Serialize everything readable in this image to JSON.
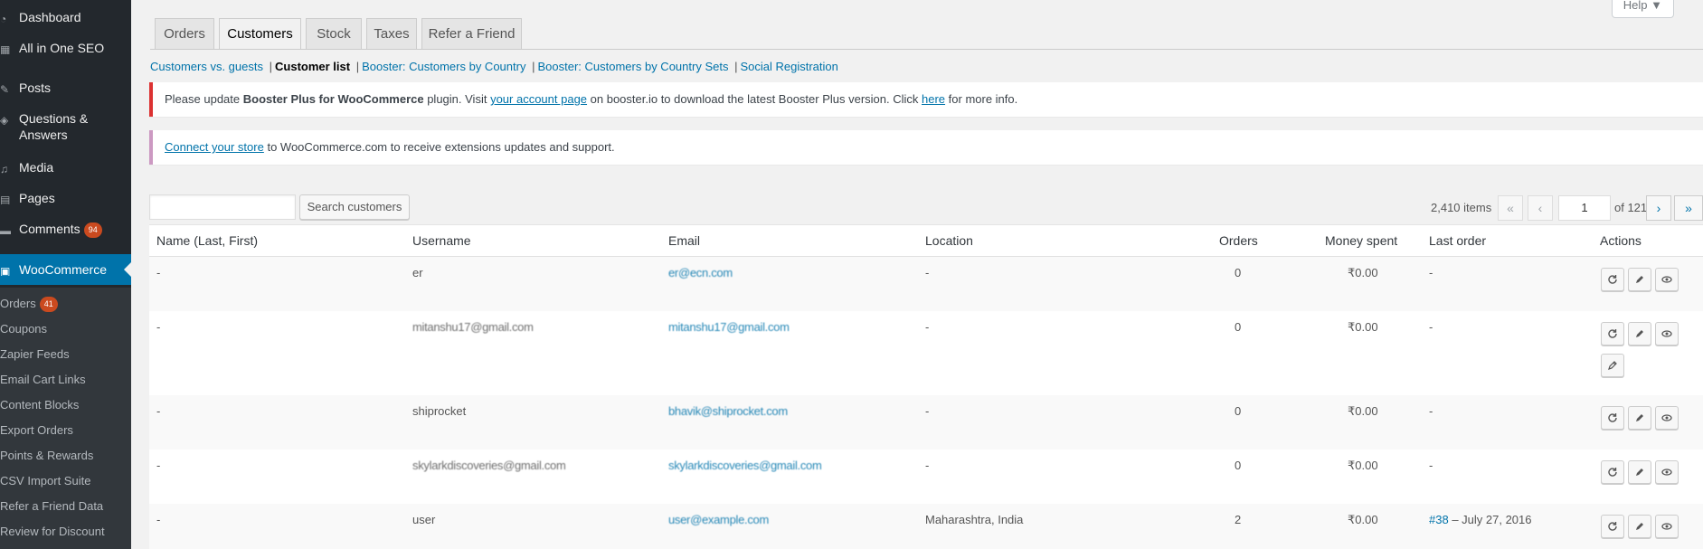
{
  "sidebar": {
    "items": [
      {
        "label": "Dashboard",
        "icon": "dashboard-icon"
      },
      {
        "label": "All in One SEO",
        "icon": "seo-icon"
      },
      {
        "label": "Posts",
        "icon": "pin-icon"
      },
      {
        "label": "Questions & Answers",
        "icon": "questions-icon"
      },
      {
        "label": "Media",
        "icon": "media-icon"
      },
      {
        "label": "Pages",
        "icon": "pages-icon"
      },
      {
        "label": "Comments",
        "icon": "comments-icon",
        "badge": "94"
      },
      {
        "label": "WooCommerce",
        "icon": "woocommerce-icon"
      }
    ],
    "submenu": [
      {
        "label": "Orders",
        "badge": "41"
      },
      {
        "label": "Coupons"
      },
      {
        "label": "Zapier Feeds"
      },
      {
        "label": "Email Cart Links"
      },
      {
        "label": "Content Blocks"
      },
      {
        "label": "Export Orders"
      },
      {
        "label": "Points & Rewards"
      },
      {
        "label": "CSV Import Suite"
      },
      {
        "label": "Refer a Friend Data"
      },
      {
        "label": "Review for Discount"
      }
    ]
  },
  "help": {
    "label": "Help ▼"
  },
  "tabs": [
    "Orders",
    "Customers",
    "Stock",
    "Taxes",
    "Refer a Friend"
  ],
  "subnav": {
    "items": [
      "Customers vs. guests",
      "Customer list",
      "Booster: Customers by Country",
      "Booster: Customers by Country Sets",
      "Social Registration"
    ],
    "separator": "|"
  },
  "notices": {
    "booster": {
      "t1": "Please update ",
      "b1": "Booster Plus for WooCommerce",
      "t2": " plugin. Visit ",
      "l1": "your account page",
      "t3": " on booster.io to download the latest Booster Plus version. Click ",
      "l2": "here",
      "t4": " for more info."
    },
    "connect": {
      "l1": "Connect your store",
      "t1": " to WooCommerce.com to receive extensions updates and support."
    }
  },
  "search": {
    "button": "Search customers",
    "value": ""
  },
  "pagination": {
    "items": "2,410 items",
    "first": "«",
    "prev": "‹",
    "current": "1",
    "of": "of 121",
    "next": "›",
    "last": "»"
  },
  "table": {
    "columns": [
      "Name (Last, First)",
      "Username",
      "Email",
      "Location",
      "Orders",
      "Money spent",
      "Last order",
      "Actions"
    ],
    "rows": [
      {
        "name": "-",
        "username": "er",
        "email": "er@ecn.com",
        "location": "-",
        "orders": "0",
        "money": "₹0.00",
        "last_order": "-",
        "last_order_link": ""
      },
      {
        "name": "-",
        "username": "mitanshu17@gmail.com",
        "email": "mitanshu17@gmail.com",
        "location": "-",
        "orders": "0",
        "money": "₹0.00",
        "last_order": "-",
        "last_order_link": ""
      },
      {
        "name": "-",
        "username": "shiprocket",
        "email": "bhavik@shiprocket.com",
        "location": "-",
        "orders": "0",
        "money": "₹0.00",
        "last_order": "-",
        "last_order_link": ""
      },
      {
        "name": "-",
        "username": "skylarkdiscoveries@gmail.com",
        "email": "skylarkdiscoveries@gmail.com",
        "location": "-",
        "orders": "0",
        "money": "₹0.00",
        "last_order": "-",
        "last_order_link": ""
      },
      {
        "name": "-",
        "username": "user",
        "email": "user@example.com",
        "location": "Maharashtra, India",
        "orders": "2",
        "money": "₹0.00",
        "last_order": " – July 27, 2016",
        "last_order_link": "#38"
      }
    ]
  },
  "colors": {
    "sidebar_bg": "#23282d",
    "accent": "#0073aa",
    "badge": "#ca4a1f",
    "error_border": "#dc3232",
    "woo_border": "#cc99c2"
  }
}
